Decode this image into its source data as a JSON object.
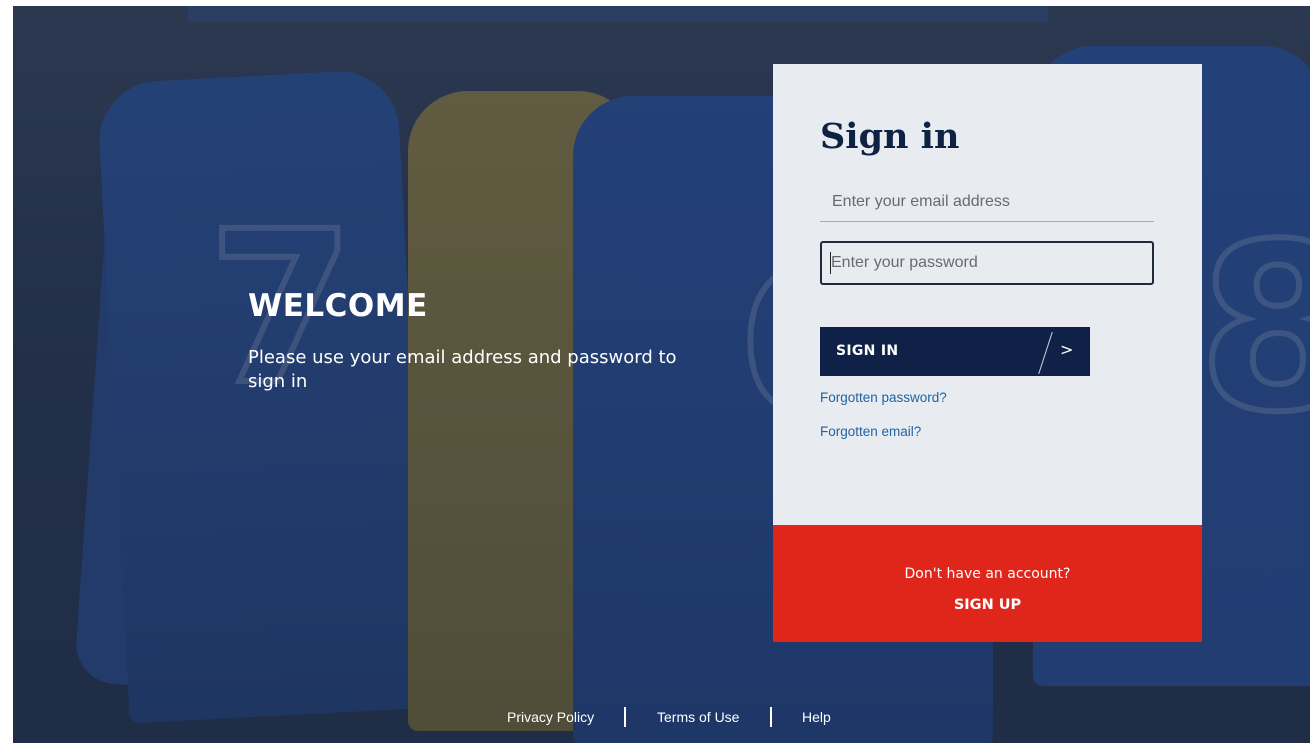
{
  "welcome": {
    "title": "WELCOME",
    "subtitle": "Please use your email address and password to sign in"
  },
  "signin": {
    "title": "Sign in",
    "email_placeholder": "Enter your email address",
    "email_value": "",
    "password_placeholder": "Enter your password",
    "password_value": "",
    "button_label": "SIGN IN",
    "button_arrow": ">",
    "forgot_password": "Forgotten password?",
    "forgot_email": "Forgotten email?"
  },
  "signup": {
    "question": "Don't have an account?",
    "link": "SIGN UP"
  },
  "footer": {
    "privacy": "Privacy Policy",
    "terms": "Terms of Use",
    "help": "Help"
  },
  "colors": {
    "navy": "#0f2146",
    "red": "#e0261b",
    "link_blue": "#1f63a6",
    "card_bg": "#e8ebf0"
  },
  "background": {
    "numerals": [
      "7",
      "6",
      "8"
    ]
  }
}
